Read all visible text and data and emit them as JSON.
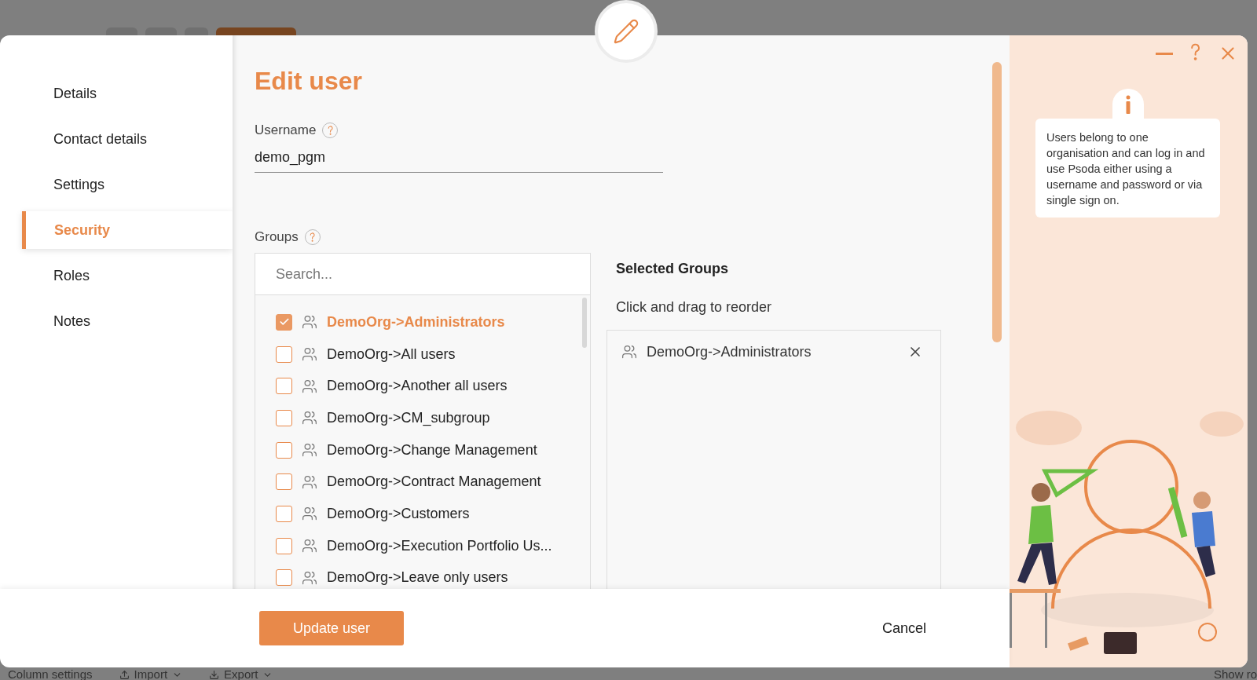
{
  "background_toolbar": [
    {
      "label": "Column settings",
      "kind": "plain"
    },
    {
      "label": "Import",
      "kind": "menu"
    },
    {
      "label": "Export",
      "kind": "menu"
    }
  ],
  "background_right": "Show ro",
  "nav": [
    {
      "label": "Details",
      "selected": false
    },
    {
      "label": "Contact details",
      "selected": false
    },
    {
      "label": "Settings",
      "selected": false
    },
    {
      "label": "Security",
      "selected": true
    },
    {
      "label": "Roles",
      "selected": false
    },
    {
      "label": "Notes",
      "selected": false
    }
  ],
  "form": {
    "title": "Edit user",
    "username": {
      "label": "Username",
      "value": "demo_pgm"
    },
    "groups": {
      "label": "Groups",
      "search": {
        "placeholder": "Search..."
      },
      "items": [
        {
          "label": "DemoOrg->Administrators",
          "checked": true
        },
        {
          "label": "DemoOrg->All users",
          "checked": false
        },
        {
          "label": "DemoOrg->Another all users",
          "checked": false
        },
        {
          "label": "DemoOrg->CM_subgroup",
          "checked": false
        },
        {
          "label": "DemoOrg->Change Management",
          "checked": false
        },
        {
          "label": "DemoOrg->Contract Management",
          "checked": false
        },
        {
          "label": "DemoOrg->Customers",
          "checked": false
        },
        {
          "label": "DemoOrg->Execution Portfolio Us...",
          "checked": false
        },
        {
          "label": "DemoOrg->Leave only users",
          "checked": false
        }
      ],
      "selected_title": "Selected Groups",
      "selected_hint": "Click and drag to reorder",
      "selected_items": [
        "DemoOrg->Administrators"
      ]
    }
  },
  "footer": {
    "primary": "Update user",
    "cancel": "Cancel"
  },
  "help": {
    "text": "Users belong to one organisation and can log in and use Psoda either using a username and password or via single sign on."
  }
}
